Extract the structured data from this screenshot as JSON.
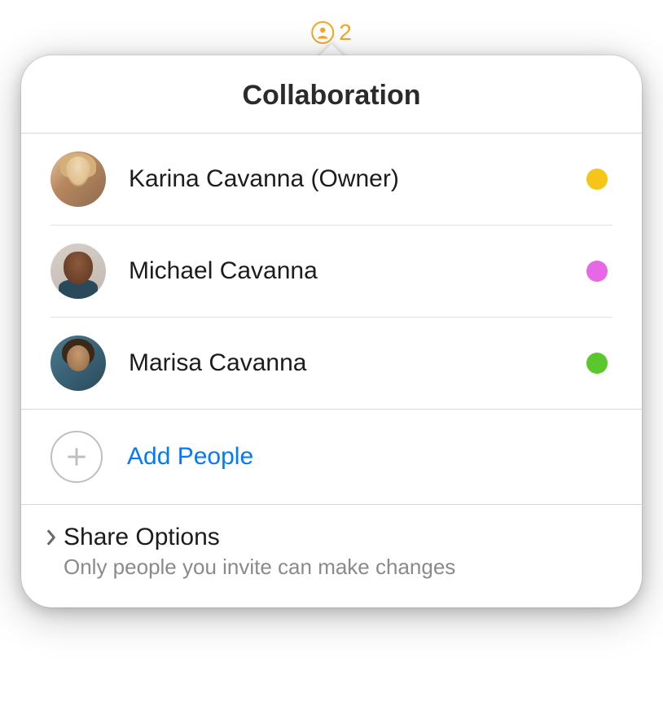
{
  "indicator": {
    "count": "2"
  },
  "popover": {
    "title": "Collaboration"
  },
  "participants": [
    {
      "name": "Karina Cavanna (Owner)",
      "presence_color": "#f5c518"
    },
    {
      "name": "Michael Cavanna",
      "presence_color": "#e768e7"
    },
    {
      "name": "Marisa Cavanna",
      "presence_color": "#5ac82c"
    }
  ],
  "add_people": {
    "label": "Add People"
  },
  "share_options": {
    "title": "Share Options",
    "subtitle": "Only people you invite can make changes"
  },
  "colors": {
    "accent_orange": "#f5a623",
    "link_blue": "#007aff"
  }
}
